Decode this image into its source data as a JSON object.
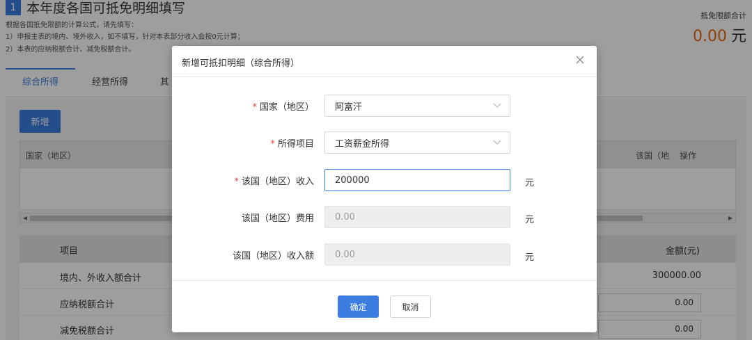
{
  "page": {
    "section_number": "1",
    "section_title": "本年度各国可抵免明细填写",
    "hint_lines": [
      "根据各国抵免限额的计算公式，请先填写：",
      "1）申报主表的境内、境外收入，如不填写，针对本表部分收入会按0元计算；",
      "2）本表的应纳税额合计、减免税额合计。"
    ],
    "total_label": "抵免限额合计",
    "total_value": "0.00",
    "total_unit": "元"
  },
  "tabs": [
    {
      "label": "综合所得",
      "active": true
    },
    {
      "label": "经营所得",
      "active": false
    },
    {
      "label": "其",
      "active": false
    }
  ],
  "panel": {
    "add_button": "新增",
    "grid_columns": {
      "country": "国家（地区）",
      "truncated": "该国（地",
      "action": "操作"
    },
    "summary_header": {
      "item": "项目",
      "amount": "金额(元)"
    },
    "summary_rows": [
      {
        "label": "境内、外收入额合计",
        "value": "300000.00",
        "boxed": false
      },
      {
        "label": "应纳税额合计",
        "value": "0.00",
        "boxed": true
      },
      {
        "label": "减免税额合计",
        "value": "0.00",
        "boxed": true
      }
    ]
  },
  "modal": {
    "title": "新增可抵扣明细（综合所得）",
    "required_mark": "*",
    "fields": [
      {
        "label": "国家（地区）",
        "value": "阿富汗",
        "required": true,
        "kind": "select"
      },
      {
        "label": "所得项目",
        "value": "工资薪金所得",
        "required": true,
        "kind": "select"
      },
      {
        "label": "该国（地区）收入",
        "value": "200000",
        "required": true,
        "kind": "input",
        "unit": "元"
      },
      {
        "label": "该国（地区）费用",
        "value": "0.00",
        "required": false,
        "kind": "disabled",
        "unit": "元"
      },
      {
        "label": "该国（地区）收入额",
        "value": "0.00",
        "required": false,
        "kind": "disabled",
        "unit": "元"
      }
    ],
    "confirm_label": "确定",
    "cancel_label": "取消"
  },
  "colors": {
    "accent": "#3b7de0",
    "required": "#e54545",
    "total": "#e8640c"
  }
}
